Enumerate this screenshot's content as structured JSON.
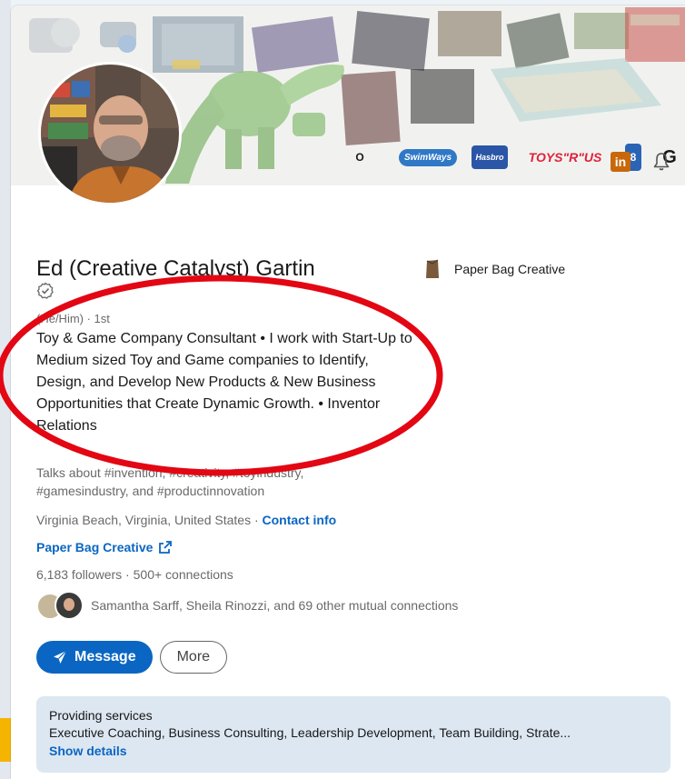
{
  "profile": {
    "name": "Ed (Creative Catalyst) Gartin",
    "pronouns_degree": "(He/Him) · 1st",
    "headline": "Toy & Game Company Consultant • I work with Start-Up to Medium sized Toy and Game companies to Identify, Design, and Develop New Products & New Business Opportunities that Create Dynamic Growth. • Inventor Relations",
    "talks_about": "Talks about #invention, #creativity, #toyindustry, #gamesindustry, and #productinnovation",
    "location": "Virginia Beach, Virginia, United States ·",
    "contact_info": "Contact info",
    "website": "Paper Bag Creative",
    "followers": "6,183 followers",
    "connections_sep": " · ",
    "connections": "500+ connections",
    "mutual": "Samantha Sarff, Sheila Rinozzi, and 69 other mutual connections"
  },
  "current_company": "Paper Bag Creative",
  "banner_brands": [
    "O",
    "SwimWays",
    "Hasbro",
    "TOYS\"R\"US",
    "8",
    "G"
  ],
  "actions": {
    "message": "Message",
    "more": "More"
  },
  "services": {
    "title": "Providing services",
    "list": "Executive Coaching, Business Consulting, Leadership Development, Team Building, Strate...",
    "show_details": "Show details"
  },
  "icons": {
    "linkedin": "in"
  },
  "colors": {
    "brand_blue": "#0a66c2",
    "annotation_red": "#e30613",
    "services_bg": "#dde7f1"
  }
}
